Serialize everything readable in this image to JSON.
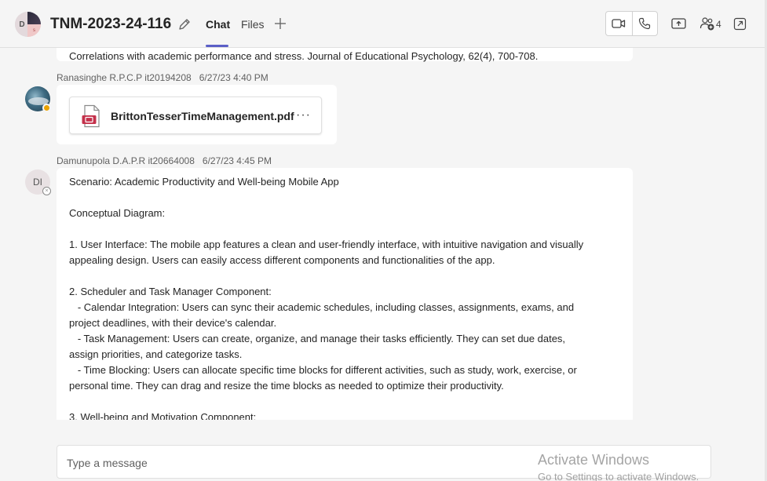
{
  "header": {
    "group_avatar_initial": "D",
    "group_avatar_corner": "s",
    "title": "TNM-2023-24-116",
    "tabs": [
      {
        "label": "Chat",
        "active": true
      },
      {
        "label": "Files",
        "active": false
      }
    ],
    "participants_count": "4"
  },
  "messages": {
    "previous_text": "Correlations with academic performance and stress. Journal of Educational Psychology, 62(4), 700-708.",
    "file_message": {
      "sender": "Ranasinghe R.P.C.P it20194208",
      "timestamp": "6/27/23 4:40 PM",
      "file_name": "BrittonTesserTimeManagement.pdf",
      "more_label": "···"
    },
    "text_message": {
      "sender": "Damunupola D.A.P.R it20664008",
      "timestamp": "6/27/23 4:45 PM",
      "avatar_initials": "DI",
      "lines": [
        "Scenario: Academic Productivity and Well-being Mobile App",
        "",
        "Conceptual Diagram:",
        "",
        "1. User Interface: The mobile app features a clean and user-friendly interface, with intuitive navigation and visually",
        "appealing design. Users can easily access different components and functionalities of the app.",
        "",
        "2. Scheduler and Task Manager Component:",
        "   - Calendar Integration: Users can sync their academic schedules, including classes, assignments, exams, and",
        "project deadlines, with their device's calendar.",
        "   - Task Management: Users can create, organize, and manage their tasks efficiently. They can set due dates,",
        "assign priorities, and categorize tasks.",
        "   - Time Blocking: Users can allocate specific time blocks for different activities, such as study, work, exercise, or",
        "personal time. They can drag and resize the time blocks as needed to optimize their productivity.",
        "",
        "3. Well-being and Motivation Component:"
      ]
    }
  },
  "compose": {
    "placeholder": "Type a message"
  },
  "watermark": {
    "title": "Activate Windows",
    "subtitle": "Go to Settings to activate Windows."
  },
  "colors": {
    "accent": "#5b5fc7",
    "away_status": "#eaa300",
    "pdf_red": "#c4314b"
  },
  "icons": [
    "edit-icon",
    "add-tab-icon",
    "video-call-icon",
    "audio-call-icon",
    "share-screen-icon",
    "people-icon",
    "pop-out-icon",
    "pdf-file-icon",
    "more-options-icon"
  ]
}
